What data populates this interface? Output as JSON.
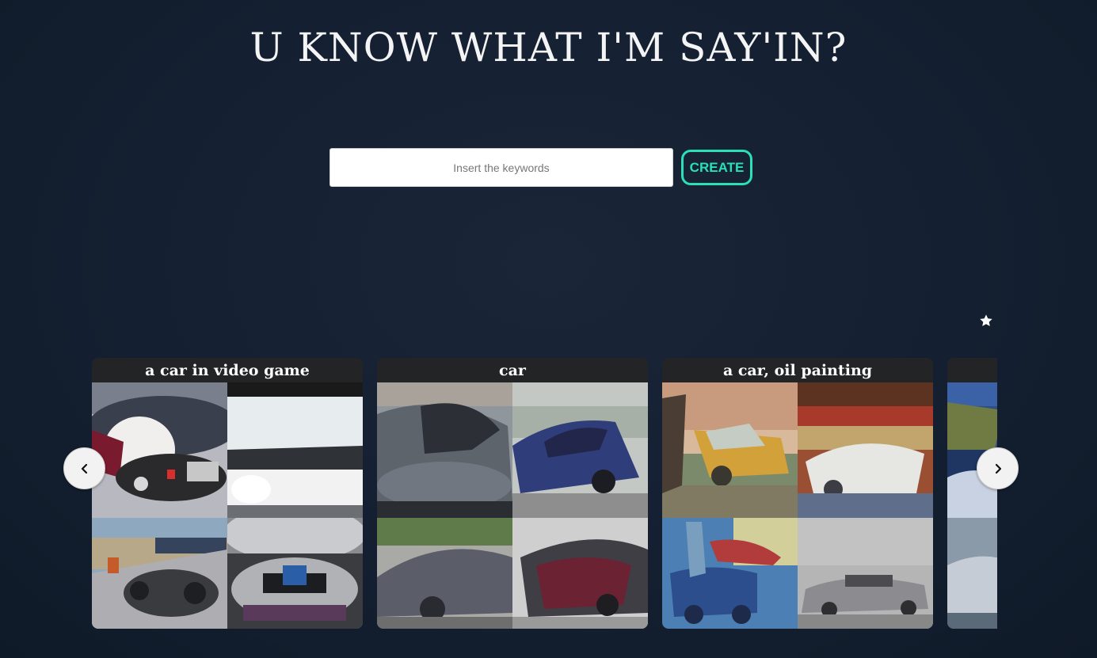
{
  "header": {
    "title": "U KNOW WHAT I'M SAY'IN?"
  },
  "search": {
    "placeholder": "Insert the keywords",
    "value": "",
    "create_label": "CREATE"
  },
  "colors": {
    "accent": "#28e0b9",
    "background": "#152133",
    "card_header": "#232426"
  },
  "icons": {
    "favorite": "star-icon",
    "prev": "chevron-left-icon",
    "next": "chevron-right-icon"
  },
  "gallery": {
    "cards": [
      {
        "title": "a car in video game",
        "images": [
          "image of a blurry rendered car interior",
          "image of a car windshield view",
          "image of a car dashboard in a game scene",
          "image of a car rear seen from behind"
        ]
      },
      {
        "title": "car",
        "images": [
          "image of a gray car",
          "image of a blue car",
          "image of a gray sports car",
          "image of a dark red car"
        ]
      },
      {
        "title": "a car, oil painting",
        "images": [
          "oil painting of a yellow car",
          "oil painting of a white car",
          "oil painting of a blue car",
          "oil painting of a gray car"
        ]
      },
      {
        "title": "",
        "images": [
          "painting of a landscape",
          "image of a car"
        ]
      }
    ]
  }
}
